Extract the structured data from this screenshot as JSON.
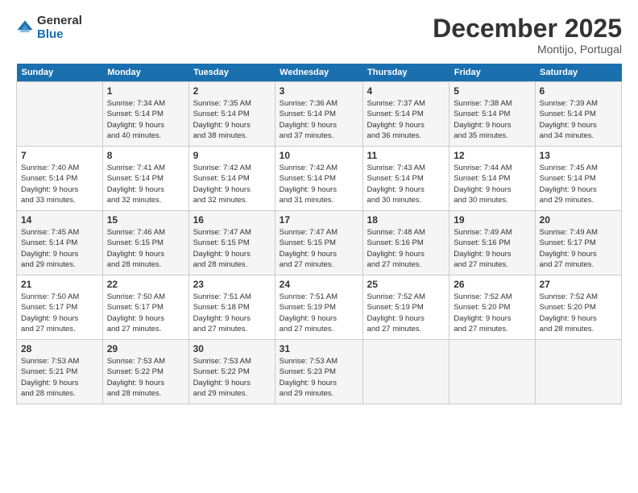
{
  "header": {
    "logo_general": "General",
    "logo_blue": "Blue",
    "month_title": "December 2025",
    "subtitle": "Montijo, Portugal"
  },
  "days_of_week": [
    "Sunday",
    "Monday",
    "Tuesday",
    "Wednesday",
    "Thursday",
    "Friday",
    "Saturday"
  ],
  "weeks": [
    [
      {
        "day": "",
        "text": ""
      },
      {
        "day": "1",
        "text": "Sunrise: 7:34 AM\nSunset: 5:14 PM\nDaylight: 9 hours\nand 40 minutes."
      },
      {
        "day": "2",
        "text": "Sunrise: 7:35 AM\nSunset: 5:14 PM\nDaylight: 9 hours\nand 38 minutes."
      },
      {
        "day": "3",
        "text": "Sunrise: 7:36 AM\nSunset: 5:14 PM\nDaylight: 9 hours\nand 37 minutes."
      },
      {
        "day": "4",
        "text": "Sunrise: 7:37 AM\nSunset: 5:14 PM\nDaylight: 9 hours\nand 36 minutes."
      },
      {
        "day": "5",
        "text": "Sunrise: 7:38 AM\nSunset: 5:14 PM\nDaylight: 9 hours\nand 35 minutes."
      },
      {
        "day": "6",
        "text": "Sunrise: 7:39 AM\nSunset: 5:14 PM\nDaylight: 9 hours\nand 34 minutes."
      }
    ],
    [
      {
        "day": "7",
        "text": "Sunrise: 7:40 AM\nSunset: 5:14 PM\nDaylight: 9 hours\nand 33 minutes."
      },
      {
        "day": "8",
        "text": "Sunrise: 7:41 AM\nSunset: 5:14 PM\nDaylight: 9 hours\nand 32 minutes."
      },
      {
        "day": "9",
        "text": "Sunrise: 7:42 AM\nSunset: 5:14 PM\nDaylight: 9 hours\nand 32 minutes."
      },
      {
        "day": "10",
        "text": "Sunrise: 7:42 AM\nSunset: 5:14 PM\nDaylight: 9 hours\nand 31 minutes."
      },
      {
        "day": "11",
        "text": "Sunrise: 7:43 AM\nSunset: 5:14 PM\nDaylight: 9 hours\nand 30 minutes."
      },
      {
        "day": "12",
        "text": "Sunrise: 7:44 AM\nSunset: 5:14 PM\nDaylight: 9 hours\nand 30 minutes."
      },
      {
        "day": "13",
        "text": "Sunrise: 7:45 AM\nSunset: 5:14 PM\nDaylight: 9 hours\nand 29 minutes."
      }
    ],
    [
      {
        "day": "14",
        "text": "Sunrise: 7:45 AM\nSunset: 5:14 PM\nDaylight: 9 hours\nand 29 minutes."
      },
      {
        "day": "15",
        "text": "Sunrise: 7:46 AM\nSunset: 5:15 PM\nDaylight: 9 hours\nand 28 minutes."
      },
      {
        "day": "16",
        "text": "Sunrise: 7:47 AM\nSunset: 5:15 PM\nDaylight: 9 hours\nand 28 minutes."
      },
      {
        "day": "17",
        "text": "Sunrise: 7:47 AM\nSunset: 5:15 PM\nDaylight: 9 hours\nand 27 minutes."
      },
      {
        "day": "18",
        "text": "Sunrise: 7:48 AM\nSunset: 5:16 PM\nDaylight: 9 hours\nand 27 minutes."
      },
      {
        "day": "19",
        "text": "Sunrise: 7:49 AM\nSunset: 5:16 PM\nDaylight: 9 hours\nand 27 minutes."
      },
      {
        "day": "20",
        "text": "Sunrise: 7:49 AM\nSunset: 5:17 PM\nDaylight: 9 hours\nand 27 minutes."
      }
    ],
    [
      {
        "day": "21",
        "text": "Sunrise: 7:50 AM\nSunset: 5:17 PM\nDaylight: 9 hours\nand 27 minutes."
      },
      {
        "day": "22",
        "text": "Sunrise: 7:50 AM\nSunset: 5:17 PM\nDaylight: 9 hours\nand 27 minutes."
      },
      {
        "day": "23",
        "text": "Sunrise: 7:51 AM\nSunset: 5:18 PM\nDaylight: 9 hours\nand 27 minutes."
      },
      {
        "day": "24",
        "text": "Sunrise: 7:51 AM\nSunset: 5:19 PM\nDaylight: 9 hours\nand 27 minutes."
      },
      {
        "day": "25",
        "text": "Sunrise: 7:52 AM\nSunset: 5:19 PM\nDaylight: 9 hours\nand 27 minutes."
      },
      {
        "day": "26",
        "text": "Sunrise: 7:52 AM\nSunset: 5:20 PM\nDaylight: 9 hours\nand 27 minutes."
      },
      {
        "day": "27",
        "text": "Sunrise: 7:52 AM\nSunset: 5:20 PM\nDaylight: 9 hours\nand 28 minutes."
      }
    ],
    [
      {
        "day": "28",
        "text": "Sunrise: 7:53 AM\nSunset: 5:21 PM\nDaylight: 9 hours\nand 28 minutes."
      },
      {
        "day": "29",
        "text": "Sunrise: 7:53 AM\nSunset: 5:22 PM\nDaylight: 9 hours\nand 28 minutes."
      },
      {
        "day": "30",
        "text": "Sunrise: 7:53 AM\nSunset: 5:22 PM\nDaylight: 9 hours\nand 29 minutes."
      },
      {
        "day": "31",
        "text": "Sunrise: 7:53 AM\nSunset: 5:23 PM\nDaylight: 9 hours\nand 29 minutes."
      },
      {
        "day": "",
        "text": ""
      },
      {
        "day": "",
        "text": ""
      },
      {
        "day": "",
        "text": ""
      }
    ]
  ]
}
